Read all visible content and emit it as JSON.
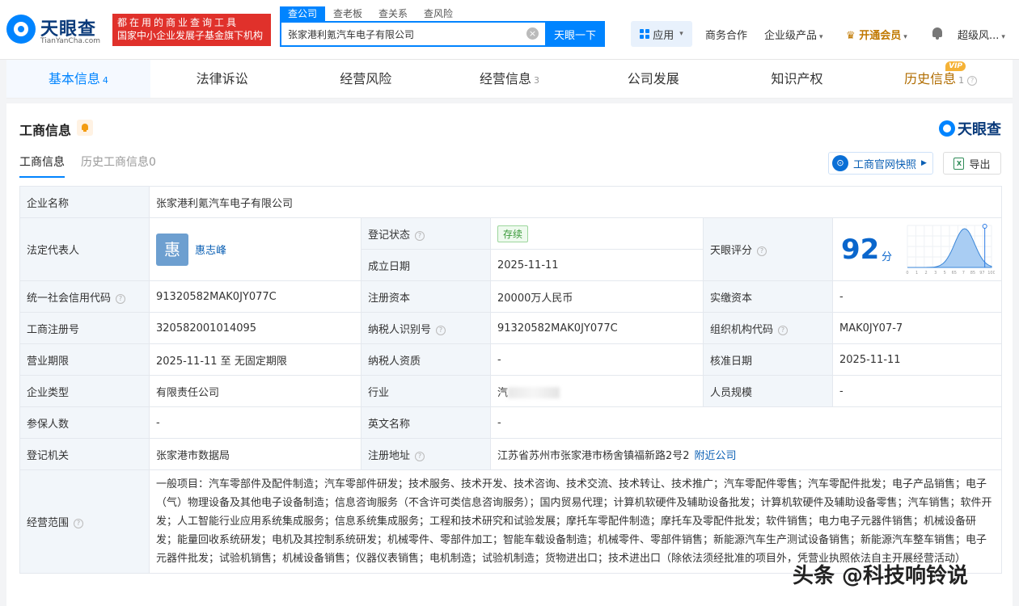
{
  "header": {
    "logo_text": "天眼查",
    "logo_sub": "TianYanCha.com",
    "slogan_line1": "都在用的商业查询工具",
    "slogan_line2": "国家中小企业发展子基金旗下机构",
    "search_tabs": [
      "查公司",
      "查老板",
      "查关系",
      "查风险"
    ],
    "search_value": "张家港利氪汽车电子有限公司",
    "search_button": "天眼一下",
    "apps_label": "应用",
    "nav": {
      "cooperation": "商务合作",
      "enterprise": "企业级产品",
      "vip": "开通会员",
      "user": "超级风..."
    }
  },
  "main_tabs": [
    {
      "label": "基本信息",
      "count": "4"
    },
    {
      "label": "法律诉讼",
      "count": ""
    },
    {
      "label": "经营风险",
      "count": ""
    },
    {
      "label": "经营信息",
      "count": "3"
    },
    {
      "label": "公司发展",
      "count": ""
    },
    {
      "label": "知识产权",
      "count": ""
    },
    {
      "label": "历史信息",
      "count": "1"
    }
  ],
  "vip_badge": "VIP",
  "section": {
    "title": "工商信息",
    "brand": "天眼查",
    "sub_tabs": [
      "工商信息",
      "历史工商信息0"
    ],
    "snapshot_button": "工商官网快照",
    "export_button": "导出"
  },
  "info": {
    "company_name_label": "企业名称",
    "company_name": "张家港利氪汽车电子有限公司",
    "legal_rep_label": "法定代表人",
    "legal_rep_avatar": "惠",
    "legal_rep_name": "惠志峰",
    "reg_status_label": "登记状态",
    "reg_status": "存续",
    "found_date_label": "成立日期",
    "found_date": "2025-11-11",
    "score_label": "天眼评分",
    "score": "92",
    "score_unit": "分",
    "credit_code_label": "统一社会信用代码",
    "credit_code": "91320582MAK0JY077C",
    "reg_capital_label": "注册资本",
    "reg_capital": "20000万人民币",
    "paid_capital_label": "实缴资本",
    "paid_capital": "-",
    "reg_no_label": "工商注册号",
    "reg_no": "320582001014095",
    "taxpayer_id_label": "纳税人识别号",
    "taxpayer_id": "91320582MAK0JY077C",
    "org_code_label": "组织机构代码",
    "org_code": "MAK0JY07-7",
    "term_label": "营业期限",
    "term": "2025-11-11 至 无固定期限",
    "taxpayer_qual_label": "纳税人资质",
    "taxpayer_qual": "-",
    "approve_date_label": "核准日期",
    "approve_date": "2025-11-11",
    "type_label": "企业类型",
    "type": "有限责任公司",
    "industry_label": "行业",
    "industry": "汽",
    "staff_label": "人员规模",
    "staff": "-",
    "insured_label": "参保人数",
    "insured": "-",
    "en_name_label": "英文名称",
    "en_name": "-",
    "authority_label": "登记机关",
    "authority": "张家港市数据局",
    "address_label": "注册地址",
    "address": "江苏省苏州市张家港市杨舍镇福新路2号2",
    "nearby_link": "附近公司",
    "scope_label": "经营范围",
    "scope": "一般项目：汽车零部件及配件制造；汽车零部件研发；技术服务、技术开发、技术咨询、技术交流、技术转让、技术推广；汽车零配件零售；汽车零配件批发；电子产品销售；电子（气）物理设备及其他电子设备制造；信息咨询服务（不含许可类信息咨询服务）；国内贸易代理；计算机软硬件及辅助设备批发；计算机软硬件及辅助设备零售；汽车销售；软件开发；人工智能行业应用系统集成服务；信息系统集成服务；工程和技术研究和试验发展；摩托车零配件制造；摩托车及零配件批发；软件销售；电力电子元器件销售；机械设备研发；能量回收系统研发；电机及其控制系统研发；机械零件、零部件加工；智能车载设备制造；机械零件、零部件销售；新能源汽车生产测试设备销售；新能源汽车整车销售；电子元器件批发；试验机销售；机械设备销售；仪器仪表销售；电机制造；试验机制造；货物进出口；技术进出口（除依法须经批准的项目外，凭营业执照依法自主开展经营活动）"
  },
  "chart_data": {
    "type": "area",
    "x_ticks": [
      "0",
      "1",
      "2",
      "3",
      "5",
      "65",
      "7",
      "85",
      "97",
      "100"
    ],
    "marker": 92,
    "xlim": [
      0,
      100
    ]
  },
  "watermark": "头条 @科技响铃说",
  "colors": {
    "accent": "#0084ff",
    "slogan": "#e0312b",
    "vip": "#c07800"
  }
}
